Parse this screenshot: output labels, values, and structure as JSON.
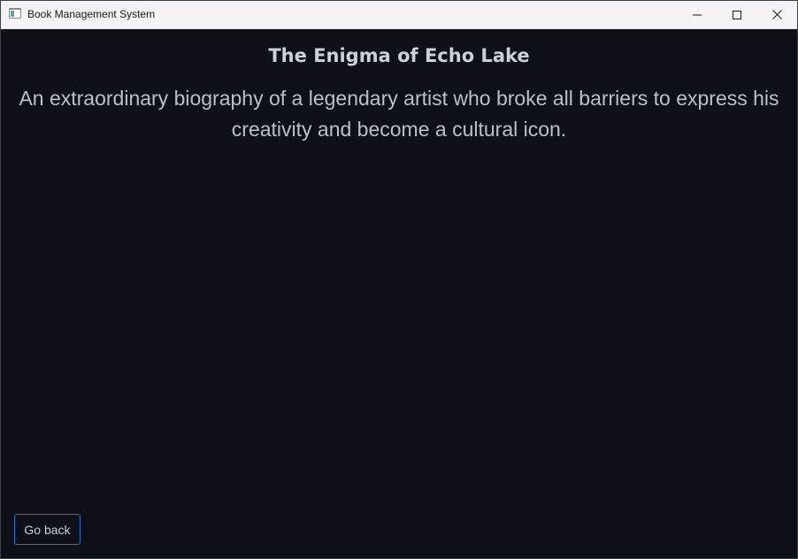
{
  "window": {
    "title": "Book Management System",
    "icon": "app-window-icon",
    "controls": [
      "minimize-icon",
      "maximize-icon",
      "close-icon"
    ]
  },
  "book": {
    "title": "The Enigma of Echo Lake",
    "description": "An extraordinary biography of a legendary artist who broke all barriers to express his creativity and become a cultural icon."
  },
  "actions": {
    "go_back_label": "Go back"
  },
  "colors": {
    "background": "#0d1117",
    "titlebar": "#f3f3f3",
    "text": "#c9d1d9",
    "button_border": "#2f6fd0"
  }
}
